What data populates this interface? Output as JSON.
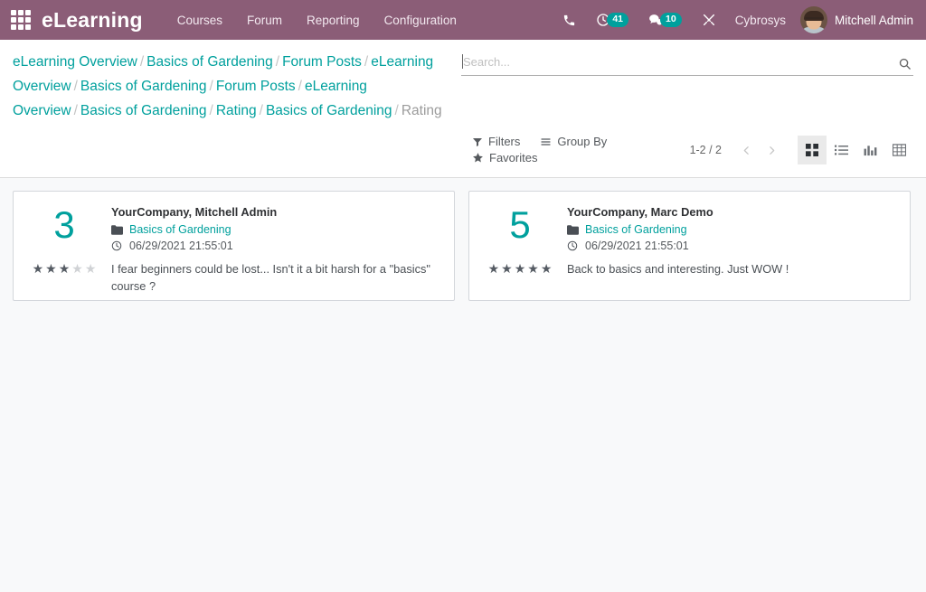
{
  "navbar": {
    "apps_icon": "apps-grid-icon",
    "brand": "eLearning",
    "menu": [
      {
        "label": "Courses"
      },
      {
        "label": "Forum"
      },
      {
        "label": "Reporting"
      },
      {
        "label": "Configuration"
      }
    ],
    "phone_icon": "phone-icon",
    "activity_icon": "clock-activity-icon",
    "activity_count": "41",
    "messages_icon": "chat-bubble-icon",
    "messages_count": "10",
    "tools_icon": "wrench-screwdriver-icon",
    "company": "Cybrosys",
    "user_name": "Mitchell Admin",
    "avatar_name": "user-avatar",
    "accent_color": "#8b5d77",
    "badge_color": "#00a09d"
  },
  "breadcrumb": {
    "items": [
      {
        "label": "eLearning Overview",
        "active": false
      },
      {
        "label": "Basics of Gardening",
        "active": false
      },
      {
        "label": "Forum Posts",
        "active": false
      },
      {
        "label": "eLearning Overview",
        "active": false
      },
      {
        "label": "Basics of Gardening",
        "active": false
      },
      {
        "label": "Forum Posts",
        "active": false
      },
      {
        "label": "eLearning Overview",
        "active": false
      },
      {
        "label": "Basics of Gardening",
        "active": false
      },
      {
        "label": "Rating",
        "active": false
      },
      {
        "label": "Basics of Gardening",
        "active": false
      },
      {
        "label": "Rating",
        "active": true
      }
    ],
    "separator": "/",
    "link_color": "#00A09D"
  },
  "search": {
    "placeholder": "Search...",
    "value": "",
    "icon": "search-icon"
  },
  "controls": {
    "filters_label": "Filters",
    "filters_icon": "filter-funnel-icon",
    "groupby_label": "Group By",
    "groupby_icon": "list-lines-icon",
    "favorites_label": "Favorites",
    "favorites_icon": "star-icon",
    "pager_text": "1-2 / 2",
    "prev_icon": "chevron-left-icon",
    "next_icon": "chevron-right-icon",
    "views": [
      {
        "name": "kanban",
        "icon": "kanban-squares-icon",
        "active": true
      },
      {
        "name": "list",
        "icon": "list-view-icon",
        "active": false
      },
      {
        "name": "graph",
        "icon": "bar-chart-icon",
        "active": false
      },
      {
        "name": "pivot",
        "icon": "pivot-table-icon",
        "active": false
      }
    ]
  },
  "records": [
    {
      "rating_value": "3",
      "stars_filled": 3,
      "stars_total": 5,
      "author": "YourCompany, Mitchell Admin",
      "course_icon": "folder-icon",
      "course": "Basics of Gardening",
      "date_icon": "clock-icon",
      "date": "06/29/2021 21:55:01",
      "comment": "I fear beginners could be lost... Isn't it a bit harsh for a \"basics\" course ?"
    },
    {
      "rating_value": "5",
      "stars_filled": 5,
      "stars_total": 5,
      "author": "YourCompany, Marc Demo",
      "course_icon": "folder-icon",
      "course": "Basics of Gardening",
      "date_icon": "clock-icon",
      "date": "06/29/2021 21:55:01",
      "comment": "Back to basics and interesting. Just WOW !"
    }
  ]
}
